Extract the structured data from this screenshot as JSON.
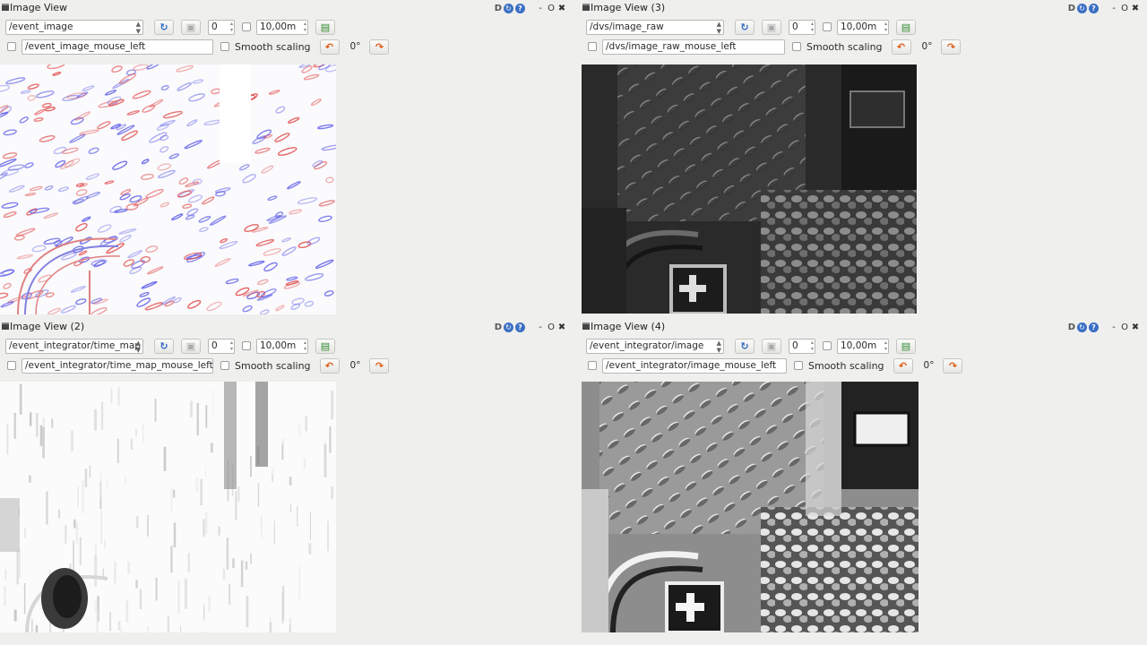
{
  "panels": [
    {
      "title": "Image View",
      "topic": "/event_image",
      "zoom": "0",
      "rate": "10,00m",
      "mouse_topic": "/event_image_mouse_left",
      "smooth_label": "Smooth scaling",
      "rotation": "0°",
      "image_kind": "event-polarity"
    },
    {
      "title": "Image View (3)",
      "topic": "/dvs/image_raw",
      "zoom": "0",
      "rate": "10,00m",
      "mouse_topic": "/dvs/image_raw_mouse_left",
      "smooth_label": "Smooth scaling",
      "rotation": "0°",
      "image_kind": "grayscale-raw"
    },
    {
      "title": "Image View (2)",
      "topic": "/event_integrator/time_map",
      "zoom": "0",
      "rate": "10,00m",
      "mouse_topic": "/event_integrator/time_map_mouse_left",
      "smooth_label": "Smooth scaling",
      "rotation": "0°",
      "image_kind": "time-map"
    },
    {
      "title": "Image View (4)",
      "topic": "/event_integrator/image",
      "zoom": "0",
      "rate": "10,00m",
      "mouse_topic": "/event_integrator/image_mouse_left",
      "smooth_label": "Smooth scaling",
      "rotation": "0°",
      "image_kind": "integrated-grayscale"
    }
  ],
  "window_controls": {
    "dock_label": "D",
    "min_label": "-",
    "float_label": "O",
    "close_label": "✖"
  },
  "colors": {
    "background": "#efefed",
    "accent_blue": "#3a6fc4",
    "rotate_orange": "#e05a14",
    "event_red": "#e04848",
    "event_blue": "#5a5ae6"
  }
}
